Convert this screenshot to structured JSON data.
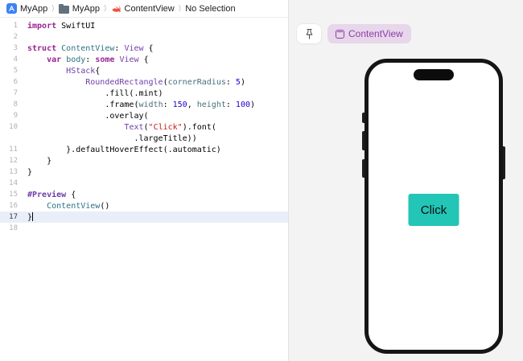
{
  "breadcrumb": {
    "items": [
      "MyApp",
      "MyApp",
      "ContentView",
      "No Selection"
    ],
    "separator": "⟩"
  },
  "editor": {
    "lines": [
      {
        "num": "1",
        "segments": [
          {
            "t": "import",
            "c": "kw"
          },
          {
            "t": " SwiftUI",
            "c": "p"
          }
        ]
      },
      {
        "num": "2",
        "segments": []
      },
      {
        "num": "3",
        "segments": [
          {
            "t": "struct",
            "c": "kw"
          },
          {
            "t": " ",
            "c": "p"
          },
          {
            "t": "ContentView",
            "c": "de"
          },
          {
            "t": ": ",
            "c": "p"
          },
          {
            "t": "View",
            "c": "ty"
          },
          {
            "t": " {",
            "c": "p"
          }
        ]
      },
      {
        "num": "4",
        "segments": [
          {
            "t": "    ",
            "c": "p"
          },
          {
            "t": "var",
            "c": "kw"
          },
          {
            "t": " ",
            "c": "p"
          },
          {
            "t": "body",
            "c": "de"
          },
          {
            "t": ": ",
            "c": "p"
          },
          {
            "t": "some",
            "c": "kw"
          },
          {
            "t": " ",
            "c": "p"
          },
          {
            "t": "View",
            "c": "ty"
          },
          {
            "t": " {",
            "c": "p"
          }
        ]
      },
      {
        "num": "5",
        "segments": [
          {
            "t": "        ",
            "c": "p"
          },
          {
            "t": "HStack",
            "c": "ty"
          },
          {
            "t": "{",
            "c": "p"
          }
        ]
      },
      {
        "num": "6",
        "segments": [
          {
            "t": "            ",
            "c": "p"
          },
          {
            "t": "RoundedRectangle",
            "c": "ty"
          },
          {
            "t": "(",
            "c": "p"
          },
          {
            "t": "cornerRadius",
            "c": "ar"
          },
          {
            "t": ": ",
            "c": "p"
          },
          {
            "t": "5",
            "c": "nu"
          },
          {
            "t": ")",
            "c": "p"
          }
        ]
      },
      {
        "num": "7",
        "segments": [
          {
            "t": "                .fill(.mint)",
            "c": "p"
          }
        ]
      },
      {
        "num": "8",
        "segments": [
          {
            "t": "                .frame(",
            "c": "p"
          },
          {
            "t": "width",
            "c": "ar"
          },
          {
            "t": ": ",
            "c": "p"
          },
          {
            "t": "150",
            "c": "nu"
          },
          {
            "t": ", ",
            "c": "p"
          },
          {
            "t": "height",
            "c": "ar"
          },
          {
            "t": ": ",
            "c": "p"
          },
          {
            "t": "100",
            "c": "nu"
          },
          {
            "t": ")",
            "c": "p"
          }
        ]
      },
      {
        "num": "9",
        "segments": [
          {
            "t": "                .overlay(",
            "c": "p"
          }
        ]
      },
      {
        "num": "10",
        "segments": [
          {
            "t": "                    ",
            "c": "p"
          },
          {
            "t": "Text",
            "c": "ty"
          },
          {
            "t": "(",
            "c": "p"
          },
          {
            "t": "\"Click\"",
            "c": "st"
          },
          {
            "t": ").font(",
            "c": "p"
          }
        ]
      },
      {
        "num": "",
        "segments": [
          {
            "t": "                      .largeTitle))",
            "c": "p"
          }
        ]
      },
      {
        "num": "11",
        "segments": [
          {
            "t": "        }.defaultHoverEffect(.automatic)",
            "c": "p"
          }
        ]
      },
      {
        "num": "12",
        "segments": [
          {
            "t": "    }",
            "c": "p"
          }
        ]
      },
      {
        "num": "13",
        "segments": [
          {
            "t": "}",
            "c": "p"
          }
        ]
      },
      {
        "num": "14",
        "segments": []
      },
      {
        "num": "15",
        "segments": [
          {
            "t": "#Preview",
            "c": "ma"
          },
          {
            "t": " {",
            "c": "p"
          }
        ]
      },
      {
        "num": "16",
        "segments": [
          {
            "t": "    ",
            "c": "p"
          },
          {
            "t": "ContentView",
            "c": "de"
          },
          {
            "t": "()",
            "c": "p"
          }
        ]
      },
      {
        "num": "17",
        "segments": [
          {
            "t": "}",
            "c": "p"
          }
        ],
        "current": true,
        "cursor": true
      },
      {
        "num": "18",
        "segments": []
      }
    ]
  },
  "canvas": {
    "tab_label": "ContentView",
    "phone": {
      "button_label": "Click"
    }
  },
  "colors": {
    "mint_shape": "#22c5b6",
    "chip_background": "#e8d6eb",
    "chip_text": "#8b3fa8",
    "canvas_background": "#f4f3f4",
    "keyword": "#9b2393",
    "type": "#703daa",
    "declaration": "#2e7186",
    "number": "#1c00cf",
    "string": "#c41a16",
    "argument_label": "#46707a",
    "current_line_highlight": "#e9eef8"
  }
}
